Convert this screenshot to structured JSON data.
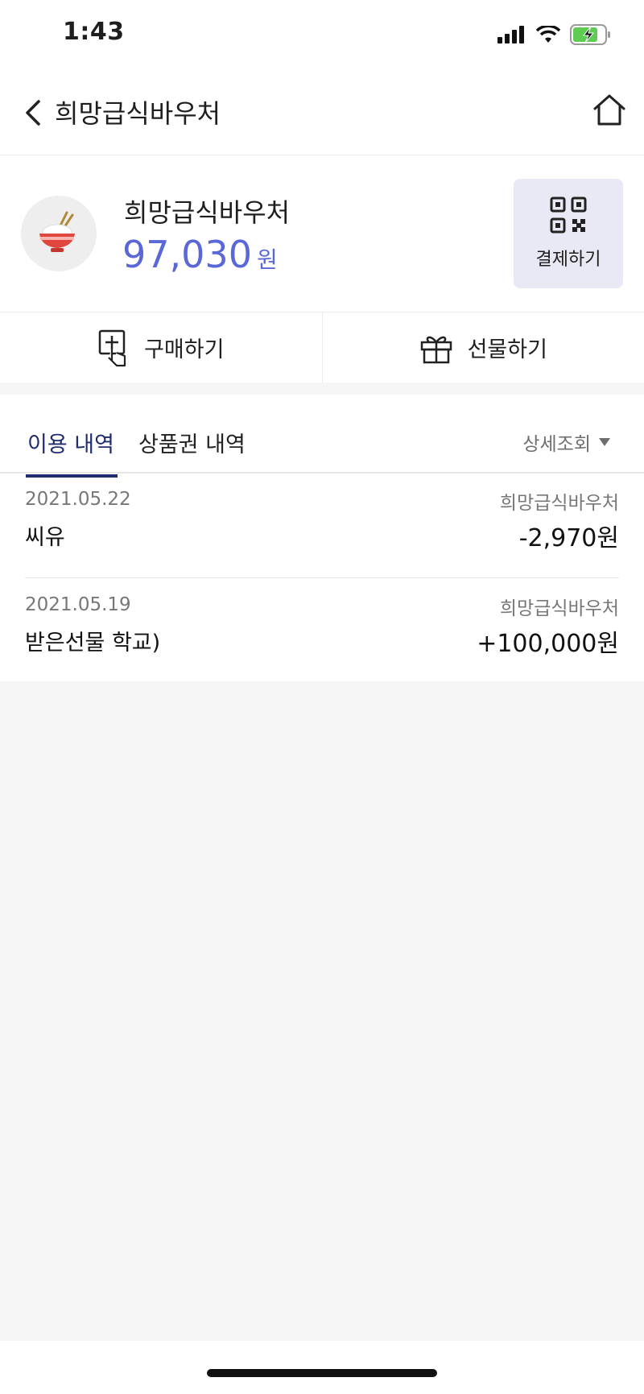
{
  "status_bar": {
    "time": "1:43"
  },
  "nav": {
    "title": "희망급식바우처"
  },
  "voucher": {
    "name": "희망급식바우처",
    "balance": "97,030",
    "unit": "원",
    "pay_label": "결제하기"
  },
  "actions": {
    "purchase": "구매하기",
    "gift": "선물하기"
  },
  "tabs": {
    "usage": "이용 내역",
    "voucher_history": "상품권 내역",
    "detail_filter": "상세조회"
  },
  "transactions": [
    {
      "date": "2021.05.22",
      "merchant": "씨유",
      "voucher": "희망급식바우처",
      "amount": "-2,970원"
    },
    {
      "date": "2021.05.19",
      "merchant": "받은선물 학교)",
      "voucher": "희망급식바우처",
      "amount": "+100,000원"
    }
  ],
  "colors": {
    "accent": "#5a67d8",
    "tab_active": "#1f2c6e",
    "pay_bg": "#e8e9f4"
  }
}
